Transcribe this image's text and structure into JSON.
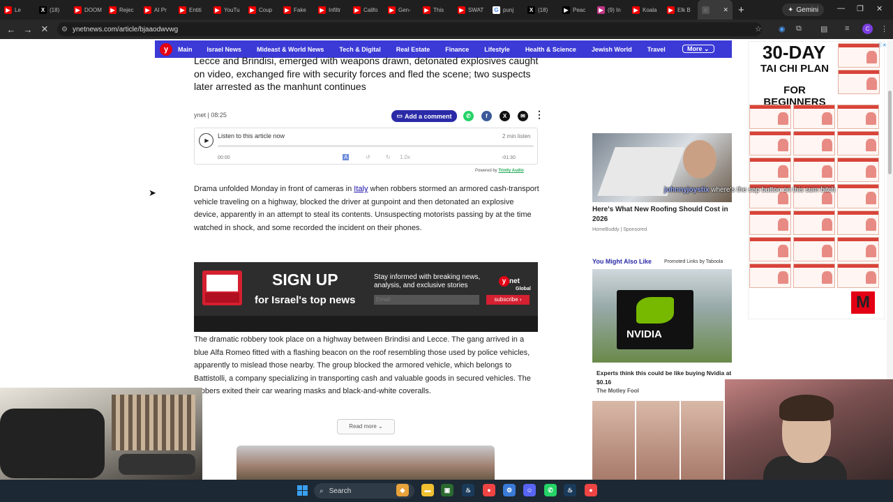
{
  "browser": {
    "tabs": [
      {
        "label": "Le",
        "icon": "youtube-icon",
        "color": "#e00"
      },
      {
        "label": "(18)",
        "icon": "x-icon",
        "color": "#000"
      },
      {
        "label": "DOOM",
        "icon": "youtube-icon",
        "color": "#e00"
      },
      {
        "label": "Rejec",
        "icon": "youtube-icon",
        "color": "#e00"
      },
      {
        "label": "AI Pr",
        "icon": "youtube-icon",
        "color": "#e00"
      },
      {
        "label": "Entiti",
        "icon": "youtube-icon",
        "color": "#e00"
      },
      {
        "label": "YouTu",
        "icon": "youtube-icon",
        "color": "#e00"
      },
      {
        "label": "Coup",
        "icon": "youtube-icon",
        "color": "#e00"
      },
      {
        "label": "Fake",
        "icon": "youtube-icon",
        "color": "#e00"
      },
      {
        "label": "Infiltr",
        "icon": "youtube-icon",
        "color": "#e00"
      },
      {
        "label": "Califo",
        "icon": "youtube-icon",
        "color": "#e00"
      },
      {
        "label": "Gen-",
        "icon": "youtube-icon",
        "color": "#e00"
      },
      {
        "label": "This",
        "icon": "youtube-icon",
        "color": "#e00"
      },
      {
        "label": "SWAT",
        "icon": "youtube-icon",
        "color": "#e00"
      },
      {
        "label": "punj",
        "icon": "google-icon",
        "color": "#fff"
      },
      {
        "label": "(18)",
        "icon": "x-icon",
        "color": "#000"
      },
      {
        "label": "Peac",
        "icon": "web-icon",
        "color": "#000"
      },
      {
        "label": "(9) In",
        "icon": "instagram-icon",
        "color": "#c13584"
      },
      {
        "label": "Koala",
        "icon": "youtube-icon",
        "color": "#e00"
      },
      {
        "label": "Elk B",
        "icon": "youtube-icon",
        "color": "#e00"
      }
    ],
    "gemini_label": "Gemini",
    "url": "ynetnews.com/article/bjaaodwvwg"
  },
  "nav": {
    "items": [
      "Main",
      "Israel News",
      "Mideast & World News",
      "Tech & Digital",
      "Real Estate",
      "Finance",
      "Lifestyle",
      "Health & Science",
      "Jewish World",
      "Travel"
    ],
    "more_label": "More"
  },
  "article": {
    "subhead": "Lecce and Brindisi, emerged with weapons drawn, detonated explosives caught on video, exchanged fire with security forces and fled the scene; two suspects later arrested as the manhunt continues",
    "byline": "ynet | 08:25",
    "comment_label": "Add a comment",
    "player": {
      "listen_label": "Listen to this article now",
      "duration": "2 min listen",
      "time_start": "00:00",
      "time_end": "-01:30",
      "speed": "1.0x",
      "powered_prefix": "Powered by",
      "powered_brand": "Trinity Audio"
    },
    "para1_before": "Drama unfolded Monday in front of cameras in ",
    "para1_link": "Italy",
    "para1_after": " when robbers stormed an armored cash-transport vehicle traveling on a highway, blocked the driver at gunpoint and then detonated an explosive device, apparently in an attempt to steal its contents. Unsuspecting motorists passing by at the time watched in shock, and some recorded the incident on their phones.",
    "para2": "The dramatic robbery took place on a highway between Brindisi and Lecce. The gang arrived in a blue Alfa Romeo fitted with a flashing beacon on the roof resembling those used by police vehicles, apparently to mislead those nearby. The group blocked the armored vehicle, which belongs to Battistolli, a company specializing in transporting cash and valuable goods in secured vehicles. The robbers exited their car wearing masks and black-and-white coveralls.",
    "read_more": "Read more"
  },
  "signup": {
    "title": "SIGN UP",
    "subtitle": "for Israel's top news",
    "desc": "Stay informed with breaking news, analysis, and exclusive stories",
    "brand": "net",
    "brand_sub": "Global",
    "email_placeholder": "Email",
    "button": "subscribe ›"
  },
  "sidebar": {
    "ad1_title": "Here's What New Roofing Should Cost in 2026",
    "ad1_source": "HomeBuddy | Sponsored",
    "ymal": "You Might Also Like",
    "promoted": "Promoted Links by Taboola",
    "nvidia_logo_text": "NVIDIA",
    "ad2_title": "Experts think this could be like buying Nvidia at $0.16",
    "ad2_source": "The Motley Fool"
  },
  "taichi_ad": {
    "title": "30-DAY",
    "subtitle": "TAI CHI PLAN",
    "subtitle2": "FOR BEGINNERS",
    "m_logo": "M"
  },
  "stream_overlay": {
    "user": "johnnyjoystix",
    "message": "where's the sap button on this sum bitch"
  },
  "taskbar": {
    "search_label": "Search"
  }
}
